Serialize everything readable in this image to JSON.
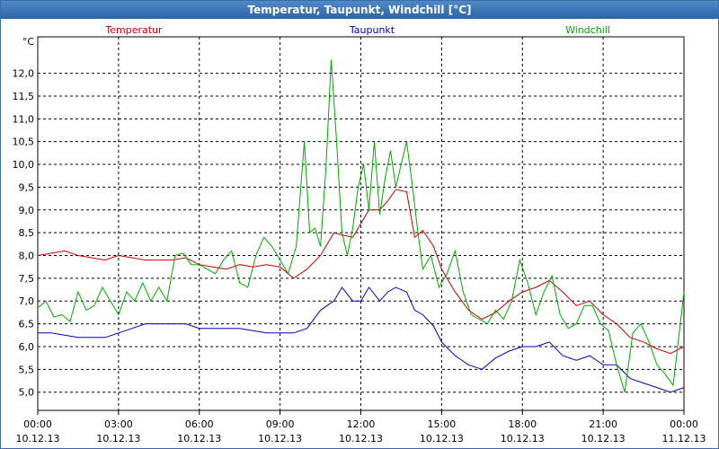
{
  "window": {
    "title": "Temperatur, Taupunkt, Windchill [°C]"
  },
  "chart_data": {
    "type": "line",
    "title": "Temperatur, Taupunkt, Windchill [°C]",
    "ylabel": "°C",
    "ylim": [
      4.6,
      12.8
    ],
    "yticks": [
      5.0,
      5.5,
      6.0,
      6.5,
      7.0,
      7.5,
      8.0,
      8.5,
      9.0,
      9.5,
      10.0,
      10.5,
      11.0,
      11.5,
      12.0
    ],
    "ytick_labels": [
      "5,0",
      "5,5",
      "6,0",
      "6,5",
      "7,0",
      "7,5",
      "8,0",
      "8,5",
      "9,0",
      "9,5",
      "10,0",
      "10,5",
      "11,0",
      "11,5",
      "12,0"
    ],
    "xlim": [
      0,
      24
    ],
    "xticks": [
      {
        "x": 0,
        "time": "00:00",
        "date": "10.12.13"
      },
      {
        "x": 3,
        "time": "03:00",
        "date": "10.12.13"
      },
      {
        "x": 6,
        "time": "06:00",
        "date": "10.12.13"
      },
      {
        "x": 9,
        "time": "09:00",
        "date": "10.12.13"
      },
      {
        "x": 12,
        "time": "12:00",
        "date": "10.12.13"
      },
      {
        "x": 15,
        "time": "15:00",
        "date": "10.12.13"
      },
      {
        "x": 18,
        "time": "18:00",
        "date": "10.12.13"
      },
      {
        "x": 21,
        "time": "21:00",
        "date": "10.12.13"
      },
      {
        "x": 24,
        "time": "00:00",
        "date": "11.12.13"
      }
    ],
    "grid": true,
    "legend_position": "top",
    "series": [
      {
        "name": "Temperatur",
        "color": "#cc0000",
        "x": [
          0,
          0.5,
          1,
          1.5,
          2,
          2.5,
          3,
          3.5,
          4,
          4.5,
          5,
          5.5,
          6,
          6.5,
          7,
          7.5,
          8,
          8.5,
          9,
          9.5,
          10,
          10.5,
          11,
          11.3,
          11.7,
          12,
          12.3,
          12.7,
          13,
          13.3,
          13.7,
          14,
          14.3,
          14.7,
          15,
          15.5,
          16,
          16.5,
          17,
          17.5,
          18,
          18.5,
          19,
          19.5,
          20,
          20.5,
          21,
          21.5,
          22,
          22.5,
          23,
          23.5,
          24
        ],
        "values": [
          8.0,
          8.05,
          8.1,
          8.0,
          7.95,
          7.9,
          8.0,
          7.95,
          7.9,
          7.9,
          7.9,
          7.95,
          7.8,
          7.75,
          7.7,
          7.8,
          7.75,
          7.8,
          7.75,
          7.5,
          7.7,
          8.0,
          8.5,
          8.45,
          8.4,
          8.7,
          9.0,
          9.0,
          9.2,
          9.45,
          9.4,
          8.4,
          8.55,
          8.2,
          7.7,
          7.2,
          6.8,
          6.6,
          6.75,
          7.0,
          7.2,
          7.3,
          7.45,
          7.2,
          6.9,
          7.0,
          6.7,
          6.5,
          6.2,
          6.1,
          5.95,
          5.85,
          6.0
        ]
      },
      {
        "name": "Taupunkt",
        "color": "#0000cc",
        "x": [
          0,
          0.5,
          1,
          1.5,
          2,
          2.5,
          3,
          3.5,
          4,
          4.5,
          5,
          5.5,
          6,
          6.5,
          7,
          7.5,
          8,
          8.5,
          9,
          9.5,
          10,
          10.5,
          11,
          11.3,
          11.7,
          12,
          12.3,
          12.7,
          13,
          13.3,
          13.7,
          14,
          14.3,
          14.7,
          15,
          15.5,
          16,
          16.5,
          17,
          17.5,
          18,
          18.5,
          19,
          19.5,
          20,
          20.5,
          21,
          21.5,
          22,
          22.5,
          23,
          23.5,
          24
        ],
        "values": [
          6.3,
          6.3,
          6.25,
          6.2,
          6.2,
          6.2,
          6.3,
          6.4,
          6.5,
          6.5,
          6.5,
          6.5,
          6.4,
          6.4,
          6.4,
          6.4,
          6.35,
          6.3,
          6.3,
          6.3,
          6.4,
          6.8,
          7.0,
          7.3,
          7.0,
          7.0,
          7.3,
          7.0,
          7.2,
          7.3,
          7.2,
          6.8,
          6.7,
          6.45,
          6.1,
          5.8,
          5.6,
          5.5,
          5.75,
          5.9,
          6.0,
          6.0,
          6.1,
          5.8,
          5.7,
          5.8,
          5.6,
          5.6,
          5.3,
          5.2,
          5.1,
          5.0,
          5.1
        ]
      },
      {
        "name": "Windchill",
        "color": "#00aa00",
        "x": [
          0,
          0.3,
          0.6,
          0.9,
          1.2,
          1.5,
          1.8,
          2.1,
          2.4,
          2.7,
          3.0,
          3.3,
          3.6,
          3.9,
          4.2,
          4.5,
          4.8,
          5.1,
          5.4,
          5.7,
          6.0,
          6.3,
          6.6,
          6.9,
          7.2,
          7.5,
          7.8,
          8.1,
          8.4,
          8.7,
          9.0,
          9.3,
          9.6,
          9.9,
          10.1,
          10.3,
          10.5,
          10.7,
          10.9,
          11.1,
          11.3,
          11.5,
          11.7,
          11.9,
          12.1,
          12.3,
          12.5,
          12.7,
          12.9,
          13.1,
          13.3,
          13.5,
          13.7,
          13.9,
          14.1,
          14.3,
          14.6,
          14.9,
          15.2,
          15.5,
          15.8,
          16.1,
          16.4,
          16.7,
          17.0,
          17.3,
          17.6,
          17.9,
          18.2,
          18.5,
          18.8,
          19.1,
          19.4,
          19.7,
          20.0,
          20.3,
          20.6,
          20.9,
          21.2,
          21.5,
          21.8,
          22.1,
          22.4,
          22.7,
          23.0,
          23.3,
          23.6,
          24.0
        ],
        "values": [
          6.85,
          7.0,
          6.65,
          6.7,
          6.55,
          7.2,
          6.8,
          6.9,
          7.3,
          7.0,
          6.7,
          7.2,
          7.0,
          7.4,
          7.0,
          7.3,
          7.0,
          8.0,
          8.05,
          7.8,
          7.8,
          7.7,
          7.6,
          7.9,
          8.1,
          7.4,
          7.3,
          8.0,
          8.4,
          8.2,
          7.9,
          7.6,
          8.2,
          10.5,
          8.5,
          8.6,
          8.2,
          9.9,
          12.3,
          10.5,
          8.5,
          8.0,
          8.6,
          9.5,
          10.0,
          9.0,
          10.5,
          8.9,
          9.7,
          10.3,
          9.5,
          10.0,
          10.5,
          9.6,
          8.6,
          7.7,
          8.0,
          7.3,
          7.6,
          8.1,
          7.2,
          6.7,
          6.6,
          6.5,
          6.8,
          6.6,
          7.0,
          7.9,
          7.4,
          6.7,
          7.2,
          7.55,
          6.7,
          6.4,
          6.5,
          6.9,
          6.9,
          6.5,
          6.35,
          5.6,
          5.0,
          6.3,
          6.5,
          6.1,
          5.6,
          5.4,
          5.15,
          7.2
        ]
      }
    ]
  }
}
